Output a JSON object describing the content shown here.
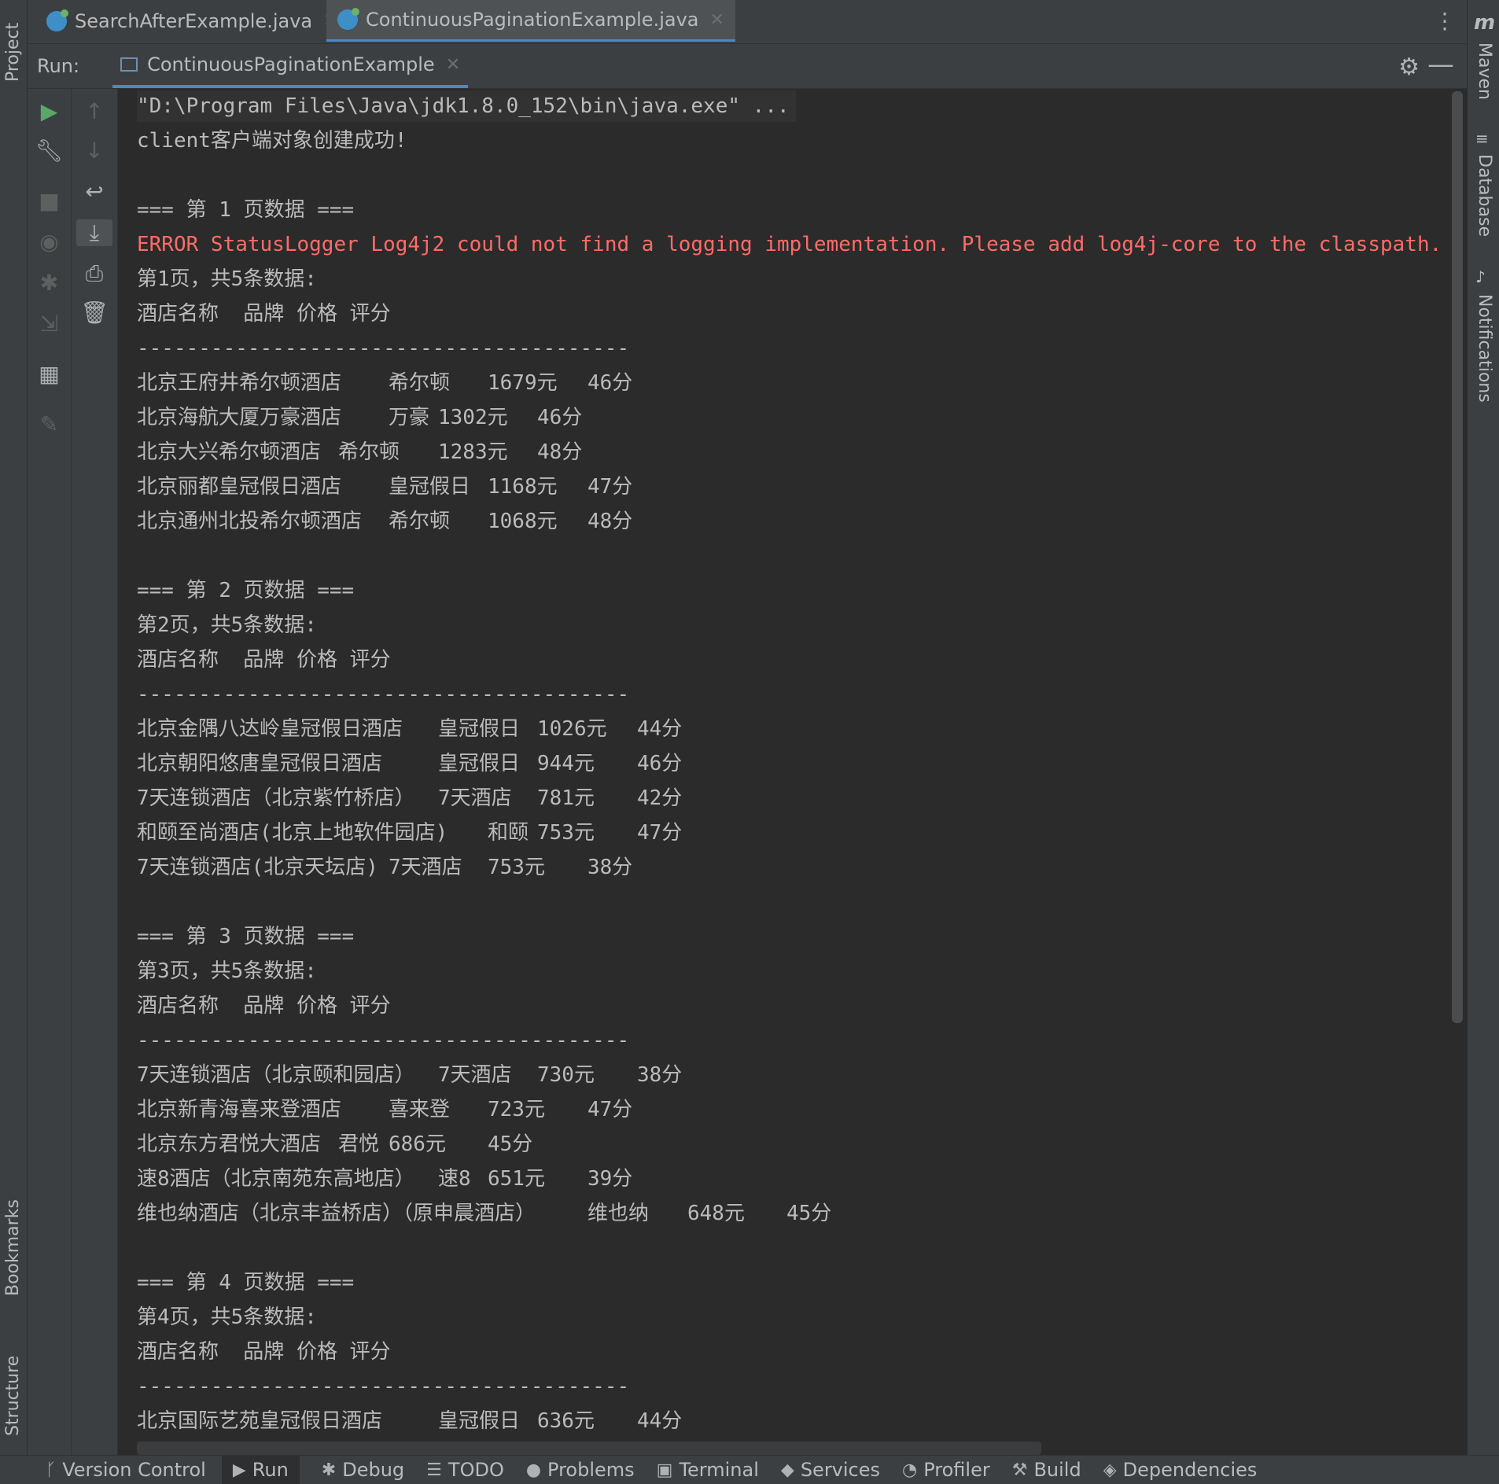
{
  "left_strip": {
    "project": "Project",
    "bookmarks": "Bookmarks",
    "structure": "Structure"
  },
  "right_strip": {
    "maven": "Maven",
    "database": "Database",
    "notifications": "Notifications"
  },
  "editor_tabs": [
    {
      "label": "SearchAfterExample.java",
      "icon": "java-class-icon",
      "active": false
    },
    {
      "label": "ContinuousPaginationExample.java",
      "icon": "java-class-icon",
      "active": true
    }
  ],
  "run_panel": {
    "label": "Run:",
    "tab": "ContinuousPaginationExample"
  },
  "console": {
    "cmd": "\"D:\\Program Files\\Java\\jdk1.8.0_152\\bin\\java.exe\" ...",
    "client_ok": "client客户端对象创建成功!",
    "error": "ERROR StatusLogger Log4j2 could not find a logging implementation. Please add log4j-core to the classpath.",
    "divider": "----------------------------------------",
    "header": "酒店名称  品牌 价格 评分",
    "pages": [
      {
        "title": "=== 第 1 页数据 ===",
        "count": "第1页，共5条数据:",
        "rows": [
          [
            "北京王府井希尔顿酒店",
            "希尔顿",
            "1679元",
            "46分"
          ],
          [
            "北京海航大厦万豪酒店",
            "万豪",
            "1302元",
            "46分"
          ],
          [
            "北京大兴希尔顿酒店",
            "希尔顿",
            "1283元",
            "48分"
          ],
          [
            "北京丽都皇冠假日酒店",
            "皇冠假日",
            "1168元",
            "47分"
          ],
          [
            "北京通州北投希尔顿酒店",
            "希尔顿",
            "1068元",
            "48分"
          ]
        ]
      },
      {
        "title": "=== 第 2 页数据 ===",
        "count": "第2页，共5条数据:",
        "rows": [
          [
            "北京金隅八达岭皇冠假日酒店",
            "皇冠假日",
            "1026元",
            "44分"
          ],
          [
            "北京朝阳悠唐皇冠假日酒店",
            "皇冠假日",
            "944元",
            "46分"
          ],
          [
            "7天连锁酒店（北京紫竹桥店）",
            "7天酒店",
            "781元",
            "42分"
          ],
          [
            "和颐至尚酒店(北京上地软件园店)",
            "和颐",
            "753元",
            "47分"
          ],
          [
            "7天连锁酒店(北京天坛店)",
            "7天酒店",
            "753元",
            "38分"
          ]
        ]
      },
      {
        "title": "=== 第 3 页数据 ===",
        "count": "第3页，共5条数据:",
        "rows": [
          [
            "7天连锁酒店（北京颐和园店）",
            "7天酒店",
            "730元",
            "38分"
          ],
          [
            "北京新青海喜来登酒店",
            "喜来登",
            "723元",
            "47分"
          ],
          [
            "北京东方君悦大酒店",
            "君悦",
            "686元",
            "45分"
          ],
          [
            "速8酒店（北京南苑东高地店）",
            "速8",
            "651元",
            "39分"
          ],
          [
            "维也纳酒店（北京丰益桥店）（原申晨酒店）",
            "维也纳",
            "648元",
            "45分"
          ]
        ]
      },
      {
        "title": "=== 第 4 页数据 ===",
        "count": "第4页，共5条数据:",
        "rows": [
          [
            "北京国际艺苑皇冠假日酒店",
            "皇冠假日",
            "636元",
            "44分"
          ]
        ]
      }
    ]
  },
  "bottom_bar": [
    {
      "label": "Version Control",
      "icon": "branch-icon"
    },
    {
      "label": "Run",
      "icon": "play-icon",
      "active": true
    },
    {
      "label": "Debug",
      "icon": "bug-icon"
    },
    {
      "label": "TODO",
      "icon": "list-icon"
    },
    {
      "label": "Problems",
      "icon": "warning-icon"
    },
    {
      "label": "Terminal",
      "icon": "terminal-icon"
    },
    {
      "label": "Services",
      "icon": "services-icon"
    },
    {
      "label": "Profiler",
      "icon": "profiler-icon"
    },
    {
      "label": "Build",
      "icon": "hammer-icon"
    },
    {
      "label": "Dependencies",
      "icon": "dependencies-icon"
    }
  ],
  "colors": {
    "background": "#2b2b2b",
    "panel": "#3c3f41",
    "error": "#ff6b68",
    "accent": "#4a88c7",
    "run_green": "#59a869"
  }
}
